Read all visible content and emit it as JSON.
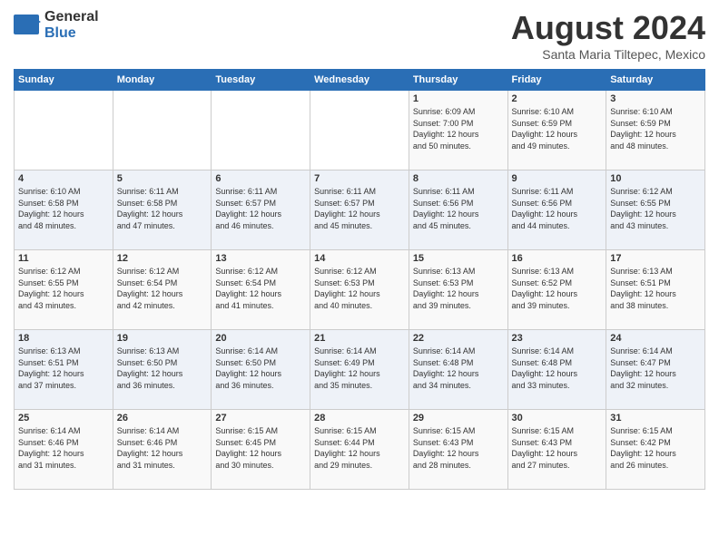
{
  "header": {
    "logo_general": "General",
    "logo_blue": "Blue",
    "month_year": "August 2024",
    "location": "Santa Maria Tiltepec, Mexico"
  },
  "calendar": {
    "headers": [
      "Sunday",
      "Monday",
      "Tuesday",
      "Wednesday",
      "Thursday",
      "Friday",
      "Saturday"
    ],
    "weeks": [
      [
        {
          "day": "",
          "info": ""
        },
        {
          "day": "",
          "info": ""
        },
        {
          "day": "",
          "info": ""
        },
        {
          "day": "",
          "info": ""
        },
        {
          "day": "1",
          "info": "Sunrise: 6:09 AM\nSunset: 7:00 PM\nDaylight: 12 hours\nand 50 minutes."
        },
        {
          "day": "2",
          "info": "Sunrise: 6:10 AM\nSunset: 6:59 PM\nDaylight: 12 hours\nand 49 minutes."
        },
        {
          "day": "3",
          "info": "Sunrise: 6:10 AM\nSunset: 6:59 PM\nDaylight: 12 hours\nand 48 minutes."
        }
      ],
      [
        {
          "day": "4",
          "info": "Sunrise: 6:10 AM\nSunset: 6:58 PM\nDaylight: 12 hours\nand 48 minutes."
        },
        {
          "day": "5",
          "info": "Sunrise: 6:11 AM\nSunset: 6:58 PM\nDaylight: 12 hours\nand 47 minutes."
        },
        {
          "day": "6",
          "info": "Sunrise: 6:11 AM\nSunset: 6:57 PM\nDaylight: 12 hours\nand 46 minutes."
        },
        {
          "day": "7",
          "info": "Sunrise: 6:11 AM\nSunset: 6:57 PM\nDaylight: 12 hours\nand 45 minutes."
        },
        {
          "day": "8",
          "info": "Sunrise: 6:11 AM\nSunset: 6:56 PM\nDaylight: 12 hours\nand 45 minutes."
        },
        {
          "day": "9",
          "info": "Sunrise: 6:11 AM\nSunset: 6:56 PM\nDaylight: 12 hours\nand 44 minutes."
        },
        {
          "day": "10",
          "info": "Sunrise: 6:12 AM\nSunset: 6:55 PM\nDaylight: 12 hours\nand 43 minutes."
        }
      ],
      [
        {
          "day": "11",
          "info": "Sunrise: 6:12 AM\nSunset: 6:55 PM\nDaylight: 12 hours\nand 43 minutes."
        },
        {
          "day": "12",
          "info": "Sunrise: 6:12 AM\nSunset: 6:54 PM\nDaylight: 12 hours\nand 42 minutes."
        },
        {
          "day": "13",
          "info": "Sunrise: 6:12 AM\nSunset: 6:54 PM\nDaylight: 12 hours\nand 41 minutes."
        },
        {
          "day": "14",
          "info": "Sunrise: 6:12 AM\nSunset: 6:53 PM\nDaylight: 12 hours\nand 40 minutes."
        },
        {
          "day": "15",
          "info": "Sunrise: 6:13 AM\nSunset: 6:53 PM\nDaylight: 12 hours\nand 39 minutes."
        },
        {
          "day": "16",
          "info": "Sunrise: 6:13 AM\nSunset: 6:52 PM\nDaylight: 12 hours\nand 39 minutes."
        },
        {
          "day": "17",
          "info": "Sunrise: 6:13 AM\nSunset: 6:51 PM\nDaylight: 12 hours\nand 38 minutes."
        }
      ],
      [
        {
          "day": "18",
          "info": "Sunrise: 6:13 AM\nSunset: 6:51 PM\nDaylight: 12 hours\nand 37 minutes."
        },
        {
          "day": "19",
          "info": "Sunrise: 6:13 AM\nSunset: 6:50 PM\nDaylight: 12 hours\nand 36 minutes."
        },
        {
          "day": "20",
          "info": "Sunrise: 6:14 AM\nSunset: 6:50 PM\nDaylight: 12 hours\nand 36 minutes."
        },
        {
          "day": "21",
          "info": "Sunrise: 6:14 AM\nSunset: 6:49 PM\nDaylight: 12 hours\nand 35 minutes."
        },
        {
          "day": "22",
          "info": "Sunrise: 6:14 AM\nSunset: 6:48 PM\nDaylight: 12 hours\nand 34 minutes."
        },
        {
          "day": "23",
          "info": "Sunrise: 6:14 AM\nSunset: 6:48 PM\nDaylight: 12 hours\nand 33 minutes."
        },
        {
          "day": "24",
          "info": "Sunrise: 6:14 AM\nSunset: 6:47 PM\nDaylight: 12 hours\nand 32 minutes."
        }
      ],
      [
        {
          "day": "25",
          "info": "Sunrise: 6:14 AM\nSunset: 6:46 PM\nDaylight: 12 hours\nand 31 minutes."
        },
        {
          "day": "26",
          "info": "Sunrise: 6:14 AM\nSunset: 6:46 PM\nDaylight: 12 hours\nand 31 minutes."
        },
        {
          "day": "27",
          "info": "Sunrise: 6:15 AM\nSunset: 6:45 PM\nDaylight: 12 hours\nand 30 minutes."
        },
        {
          "day": "28",
          "info": "Sunrise: 6:15 AM\nSunset: 6:44 PM\nDaylight: 12 hours\nand 29 minutes."
        },
        {
          "day": "29",
          "info": "Sunrise: 6:15 AM\nSunset: 6:43 PM\nDaylight: 12 hours\nand 28 minutes."
        },
        {
          "day": "30",
          "info": "Sunrise: 6:15 AM\nSunset: 6:43 PM\nDaylight: 12 hours\nand 27 minutes."
        },
        {
          "day": "31",
          "info": "Sunrise: 6:15 AM\nSunset: 6:42 PM\nDaylight: 12 hours\nand 26 minutes."
        }
      ]
    ]
  }
}
